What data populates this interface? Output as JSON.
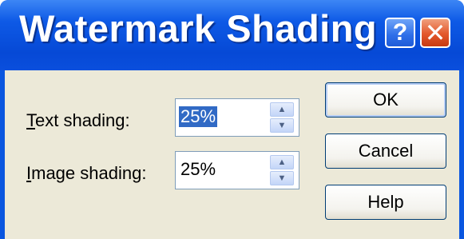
{
  "window": {
    "title": "Watermark Shading",
    "help_glyph": "?",
    "close_glyph": "✕"
  },
  "fields": {
    "text_shading": {
      "accel": "T",
      "label_rest": "ext shading:",
      "value": "25%"
    },
    "image_shading": {
      "accel": "I",
      "label_rest": "mage shading:",
      "value": "25%"
    }
  },
  "spin": {
    "up_glyph": "▲",
    "down_glyph": "▼"
  },
  "buttons": {
    "ok": "OK",
    "cancel": "Cancel",
    "help": "Help"
  },
  "colors": {
    "titlebar": "#0a56e0",
    "client": "#ece9d8",
    "selection": "#316ac5",
    "close": "#e3572b"
  }
}
